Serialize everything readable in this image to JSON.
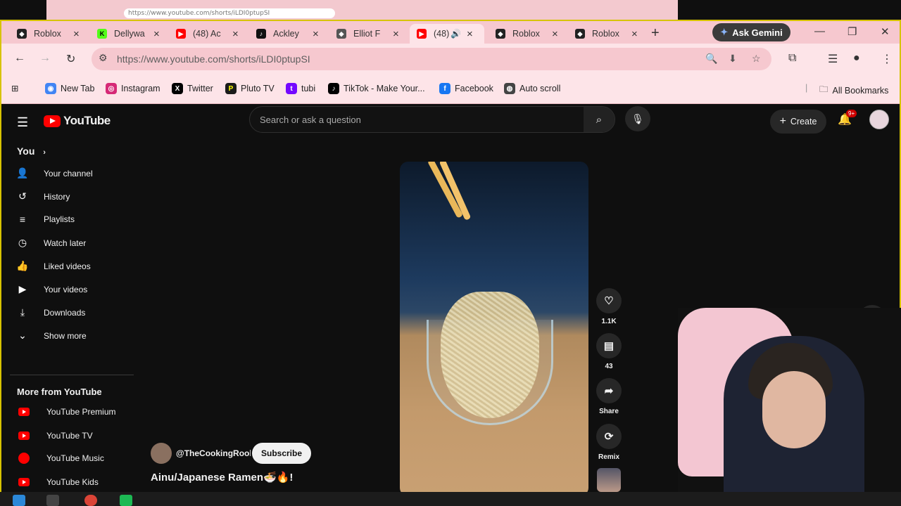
{
  "behind_window": {
    "url": "https://www.youtube.com/shorts/iLDI0ptupSI"
  },
  "tabs": [
    {
      "title": "Roblox",
      "icon": "roblox-icon",
      "color": "#222222"
    },
    {
      "title": "Dellywa",
      "icon": "kick-icon",
      "color": "#53fc18"
    },
    {
      "title": "(48) Ac",
      "icon": "youtube-icon",
      "color": "#ff0000"
    },
    {
      "title": "Ackley",
      "icon": "tiktok-icon",
      "color": "#111111"
    },
    {
      "title": "Elliot F",
      "icon": "roblox-icon",
      "color": "#555555"
    },
    {
      "title": "(48)",
      "icon": "youtube-icon",
      "color": "#ff0000",
      "active": true
    },
    {
      "title": "Roblox",
      "icon": "roblox-icon",
      "color": "#222222"
    },
    {
      "title": "Roblox",
      "icon": "roblox-icon",
      "color": "#222222"
    }
  ],
  "gemini_label": "Ask Gemini",
  "address": {
    "url": "https://www.youtube.com/shorts/iLDI0ptupSI"
  },
  "bookmarks": [
    {
      "label": "New Tab",
      "icon": "chrome-icon",
      "color": "#4285f4"
    },
    {
      "label": "Instagram",
      "icon": "instagram-icon",
      "color": "#d62976"
    },
    {
      "label": "Twitter",
      "icon": "x-icon",
      "color": "#000000"
    },
    {
      "label": "Pluto TV",
      "icon": "plutotv-icon",
      "color": "#1b1b1b"
    },
    {
      "label": "tubi",
      "icon": "tubi-icon",
      "color": "#7408ff"
    },
    {
      "label": "TikTok - Make Your...",
      "icon": "tiktok-icon",
      "color": "#000000"
    },
    {
      "label": "Facebook",
      "icon": "facebook-icon",
      "color": "#1877f2"
    },
    {
      "label": "Auto scroll",
      "icon": "globe-icon",
      "color": "#444444"
    }
  ],
  "all_bookmarks": "All Bookmarks",
  "youtube": {
    "logo": "YouTube",
    "search_placeholder": "Search or ask a question",
    "create_label": "Create",
    "notif_count": "9+",
    "sidebar": {
      "you_label": "You",
      "items": [
        "Your channel",
        "History",
        "Playlists",
        "Watch later",
        "Liked videos",
        "Your videos",
        "Downloads",
        "Show more"
      ],
      "more_header": "More from YouTube",
      "more_items": [
        "YouTube Premium",
        "YouTube TV",
        "YouTube Music",
        "YouTube Kids"
      ]
    },
    "short": {
      "likes": "1.1K",
      "comments": "43",
      "share": "Share",
      "remix": "Remix",
      "channel": "@TheCookingRooki",
      "subscribe": "Subscribe",
      "title": "Ainu/Japanese Ramen🍜🔥!"
    }
  }
}
